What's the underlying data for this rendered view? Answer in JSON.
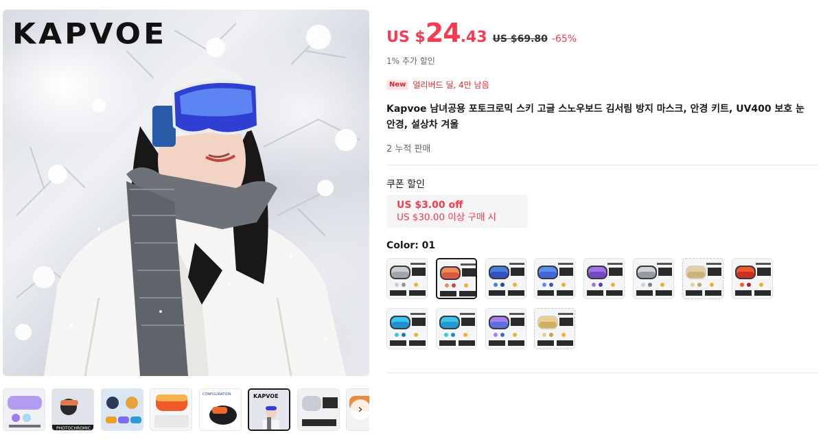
{
  "gallery": {
    "brand": "KAPVOE",
    "thumbnails": [
      {
        "name": "thumb-1"
      },
      {
        "name": "thumb-2",
        "label": "PHOTOCHROMIC"
      },
      {
        "name": "thumb-3"
      },
      {
        "name": "thumb-4"
      },
      {
        "name": "thumb-5",
        "label": "CONFIGURATION DISPLAY"
      },
      {
        "name": "thumb-6",
        "label": "KAPVOE"
      },
      {
        "name": "thumb-7"
      },
      {
        "name": "thumb-8"
      }
    ],
    "next_icon": "chevron-right-icon"
  },
  "price": {
    "currency": "US $",
    "integer": "24",
    "decimal": ".43",
    "original": "US $69.80",
    "discount": "-65%"
  },
  "extra_discount": "1% 추가 할인",
  "promo": {
    "badge": "New",
    "text": "얼리버드 딜, 4만 남음"
  },
  "title": "Kapvoe 남녀공용 포토크로믹 스키 고글 스노우보드 김서림 방지 마스크, 안경 키트, UV400 보호 눈 안경, 설상차 겨울",
  "sold": "2 누적 판매",
  "coupon": {
    "heading": "쿠폰 할인",
    "amount": "US $3.00 off",
    "condition": "US $30.00 이상 구매 시"
  },
  "color": {
    "label": "Color: 01",
    "selected_index": 1,
    "swatches": [
      {
        "lens": "#c9ccd2",
        "lens2": "#8e939c",
        "frame": "#3a3a3a"
      },
      {
        "lens": "#f08a5b",
        "lens2": "#c7473a",
        "frame": "#3a3a3a"
      },
      {
        "lens": "#4a7fe0",
        "lens2": "#2a3fb0",
        "frame": "#3a3a3a"
      },
      {
        "lens": "#5b8ff0",
        "lens2": "#3b53c9",
        "frame": "#3a3a3a"
      },
      {
        "lens": "#a472e6",
        "lens2": "#5c3bb3",
        "frame": "#3a3a3a"
      },
      {
        "lens": "#cfd2d8",
        "lens2": "#7d828b",
        "frame": "#3a3a3a"
      },
      {
        "lens": "#e2cfa4",
        "lens2": "#c2a46c",
        "frame": "#d8cfbd"
      },
      {
        "lens": "#f05a2a",
        "lens2": "#b61f1f",
        "frame": "#3a3a3a"
      },
      {
        "lens": "#3cc4f0",
        "lens2": "#1878c4",
        "frame": "#3a3a3a"
      },
      {
        "lens": "#3cc4e8",
        "lens2": "#1a88c8",
        "frame": "#3a3a3a"
      },
      {
        "lens": "#a680f0",
        "lens2": "#3c6bd9",
        "frame": "#3a3a3a"
      },
      {
        "lens": "#e8cf90",
        "lens2": "#c7a050",
        "frame": "#d8cfbd"
      }
    ]
  }
}
